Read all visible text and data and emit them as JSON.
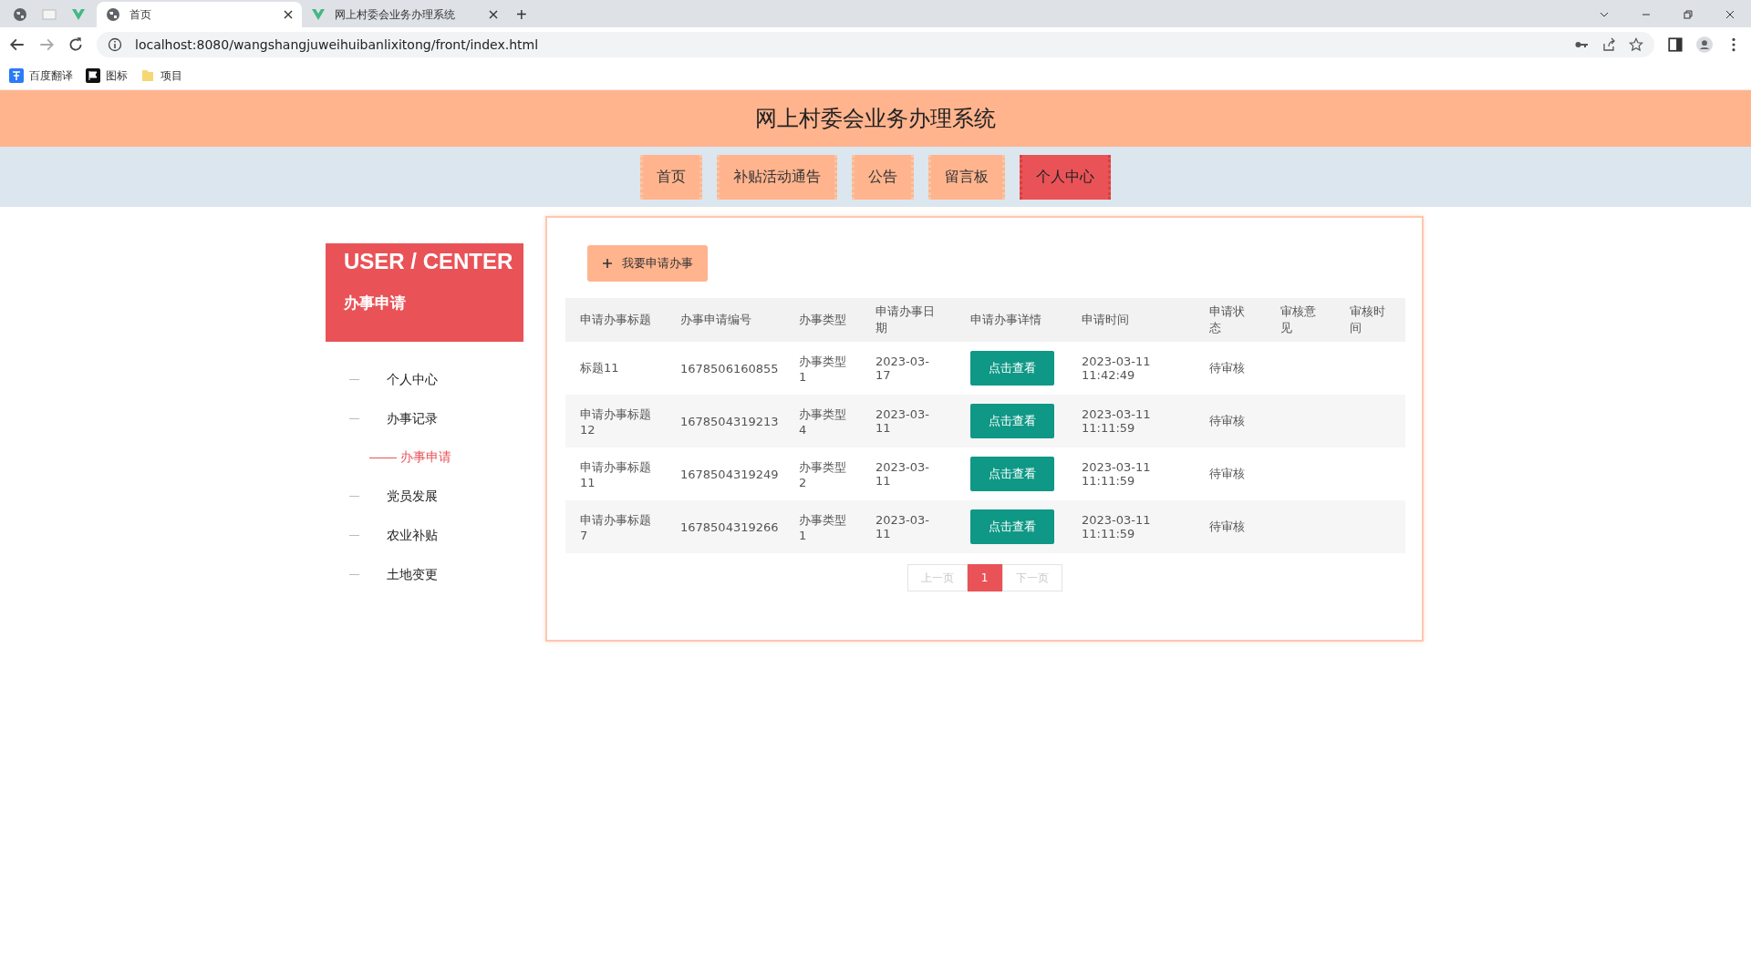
{
  "browser": {
    "tabs": [
      {
        "title": "首页",
        "selected": true
      },
      {
        "title": "网上村委会业务办理系统",
        "selected": false
      }
    ],
    "new_tab": "+",
    "url": "localhost:8080/wangshangjuweihuibanlixitong/front/index.html",
    "bookmarks": [
      {
        "label": "百度翻译"
      },
      {
        "label": "图标"
      },
      {
        "label": "项目"
      }
    ]
  },
  "site_title": "网上村委会业务办理系统",
  "nav": [
    {
      "label": "首页",
      "selected": false
    },
    {
      "label": "补贴活动通告",
      "selected": false
    },
    {
      "label": "公告",
      "selected": false
    },
    {
      "label": "留言板",
      "selected": false
    },
    {
      "label": "个人中心",
      "selected": true
    }
  ],
  "sidebar": {
    "title": "USER / CENTER",
    "subtitle": "办事申请",
    "items": [
      {
        "label": "个人中心",
        "selected": false
      },
      {
        "label": "办事记录",
        "selected": false,
        "children": [
          {
            "label": "办事申请",
            "selected": true
          }
        ]
      },
      {
        "label": "党员发展",
        "selected": false
      },
      {
        "label": "农业补贴",
        "selected": false
      },
      {
        "label": "土地变更",
        "selected": false
      }
    ]
  },
  "add_button": "我要申请办事",
  "table": {
    "columns": [
      "申请办事标题",
      "办事申请编号",
      "办事类型",
      "申请办事日期",
      "申请办事详情",
      "申请时间",
      "申请状态",
      "审核意见",
      "审核时间"
    ],
    "rows": [
      {
        "title": "标题11",
        "code": "1678506160855",
        "type": "办事类型1",
        "date": "2023-03-17",
        "details": "点击查看",
        "time": "2023-03-11 11:42:49",
        "status": "待审核"
      },
      {
        "title": "申请办事标题12",
        "code": "1678504319213",
        "type": "办事类型4",
        "date": "2023-03-11",
        "details": "点击查看",
        "time": "2023-03-11 11:11:59",
        "status": "待审核"
      },
      {
        "title": "申请办事标题11",
        "code": "1678504319249",
        "type": "办事类型2",
        "date": "2023-03-11",
        "details": "点击查看",
        "time": "2023-03-11 11:11:59",
        "status": "待审核"
      },
      {
        "title": "申请办事标题7",
        "code": "1678504319266",
        "type": "办事类型1",
        "date": "2023-03-11",
        "details": "点击查看",
        "time": "2023-03-11 11:11:59",
        "status": "待审核"
      }
    ]
  },
  "pagination": {
    "prev": {
      "label": "上一页",
      "disabled": true
    },
    "pages": [
      {
        "label": "1",
        "selected": true
      }
    ],
    "next": {
      "label": "下一页",
      "disabled": true
    }
  }
}
